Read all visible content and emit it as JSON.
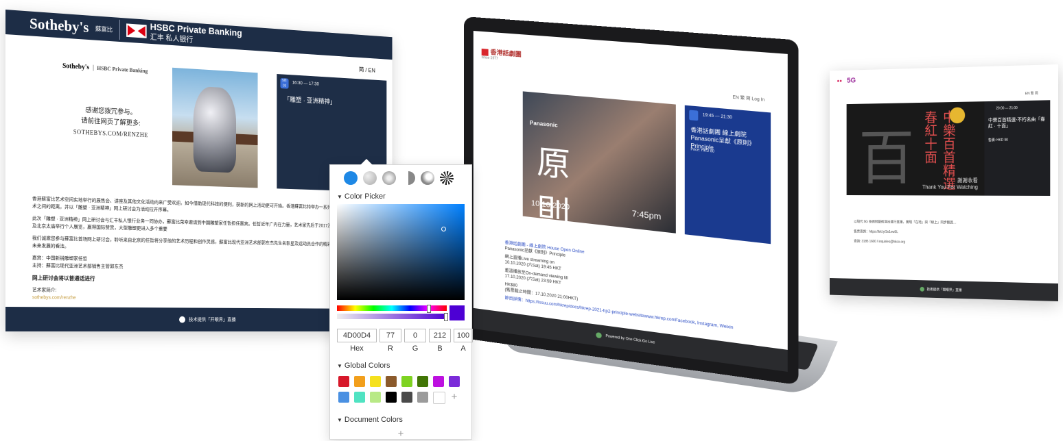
{
  "sothebys": {
    "brand": "Sotheby's",
    "brand_cn": "蘇富比",
    "hsbc_title": "HSBC Private Banking",
    "hsbc_sub": "汇丰 私人银行",
    "lang": "简 / EN",
    "thanks_line1": "感谢您拨冗参与。",
    "thanks_line2": "请前往网页了解更多:",
    "thanks_url": "SOTHEBYS.COM/RENZHE",
    "event_badge": "9月 03",
    "event_time": "16:30 — 17:30",
    "event_title": "「雕塑 · 亚洲精神」",
    "para1": "香港蘇富比艺术空间实地举行的展售会、讲座及其他文化活动向来广受欢迎。如今借助现代科技的便利，获新的网上活动更可开始。香港蘇富比特举办一系列网上活动，拉近大众与艺术之间的距离，并以「雕塑 · 亚洲精神」网上研讨会为活动拉开序幕。",
    "para2": "此次「雕塑 · 亚洲精神」网上研讨会与汇丰私人银行业务一同协办，蘇富比荣幸邀请到中国雕塑家任哲担任嘉宾。任哲近年广内在力量，艺术家先后于2017及2019年在香港交易广场及北京太庙举行个人展览，赢得国际赞赏，大型雕塑更进入多个重要",
    "para3": "我们诚邀您参与蘇富比首场网上研讨会，聆听来自北京的任哲将分享他的艺术历程和创作灵感，蘇富比现代亚洲艺术部郭东杰先生名影星及运动员合作的精彩故事，以及他对亚洲雕塑未来发展的看法。",
    "guest": "嘉宾：中国新锐雕塑家任哲",
    "host": "主持：蘇富比现代亚洲艺术部销售主管郭东杰",
    "note": "网上研讨会将以普通话进行",
    "artist_intro": "艺术家简介:",
    "artist_link": "sothebys.com/renzhe",
    "footer": "技术提供「开眼界」直播"
  },
  "picker": {
    "section_title": "Color Picker",
    "hex": "4D00D4",
    "r": "77",
    "g": "0",
    "b": "212",
    "a": "100",
    "hex_label": "Hex",
    "r_label": "R",
    "g_label": "G",
    "b_label": "B",
    "a_label": "A",
    "global_title": "Global Colors",
    "document_title": "Document Colors",
    "current_color": "#4d00d4",
    "hue_level": 0.84,
    "alpha_level": 1.0,
    "global_colors": [
      "#d7182a",
      "#f29f1c",
      "#f5e11d",
      "#8b5a2b",
      "#7ed321",
      "#417505",
      "#bd10e0",
      "#7b2bd9",
      "#4a90e2",
      "#50e3c2",
      "#b8e986",
      "#000000",
      "#4a4a4a",
      "#9b9b9b",
      "#ffffff"
    ]
  },
  "laptop": {
    "logo": "香港話劇團",
    "logo_sub": "since 1977",
    "lang": "EN 繁 简  Log In",
    "poster_big": "原 則",
    "poster_brand": "Panasonic",
    "poster_date": "10.10.2020",
    "poster_time": "7:45pm",
    "event_time": "19:45 — 21:30",
    "event_title": "香港話劇團 線上劇院 Panasonic呈獻《原則》Principle",
    "event_price": "Price: HKD 80",
    "body_title": "香港話劇團 - 線上劇院 House Open Online",
    "body_sub": "Panasonic呈獻《原則》Principle",
    "live": "網上直播Live streaming on",
    "live_date": "10.10.2020 (六Sat) 19:45 HKT",
    "ondemand": "重溫播放至On-demand viewing till",
    "ondemand_date": "17.10.2020 (六Sat) 23:59 HKT",
    "price": "HK$80",
    "deadline": "(售票截止時間：17.10.2020 21:00HKT)",
    "program": "節目詳情：https://issuu.com/hkrep/docs/hkrep-2021-hp2-principle-websitewww.hkrep.comFacebook, Instagram, Weixin",
    "footer": "Powered by One Click Go Live"
  },
  "right": {
    "logo_5g": "5G",
    "lang": "EN 繁 简",
    "poster_char": "百",
    "poster_red": "中樂百首精選 春紅十面",
    "poster_thanks": "謝謝收看\nThank You For Watching",
    "event_time": "20:00 — 21:00",
    "event_title": "中樂百首精選-不朽名曲「春紅 · 十面」",
    "event_price": "售價: HKD 90",
    "body": "以現代 5G 技術對藝術演出進行直播，實現「在地」與「線上」同步觀賞…",
    "link": "售票查詢：https://bit.ly/3o1nw5L",
    "contact": "查詢: 3185 1600 / inquiries@hkco.org",
    "footer": "技術提供「開眼界」直播"
  }
}
